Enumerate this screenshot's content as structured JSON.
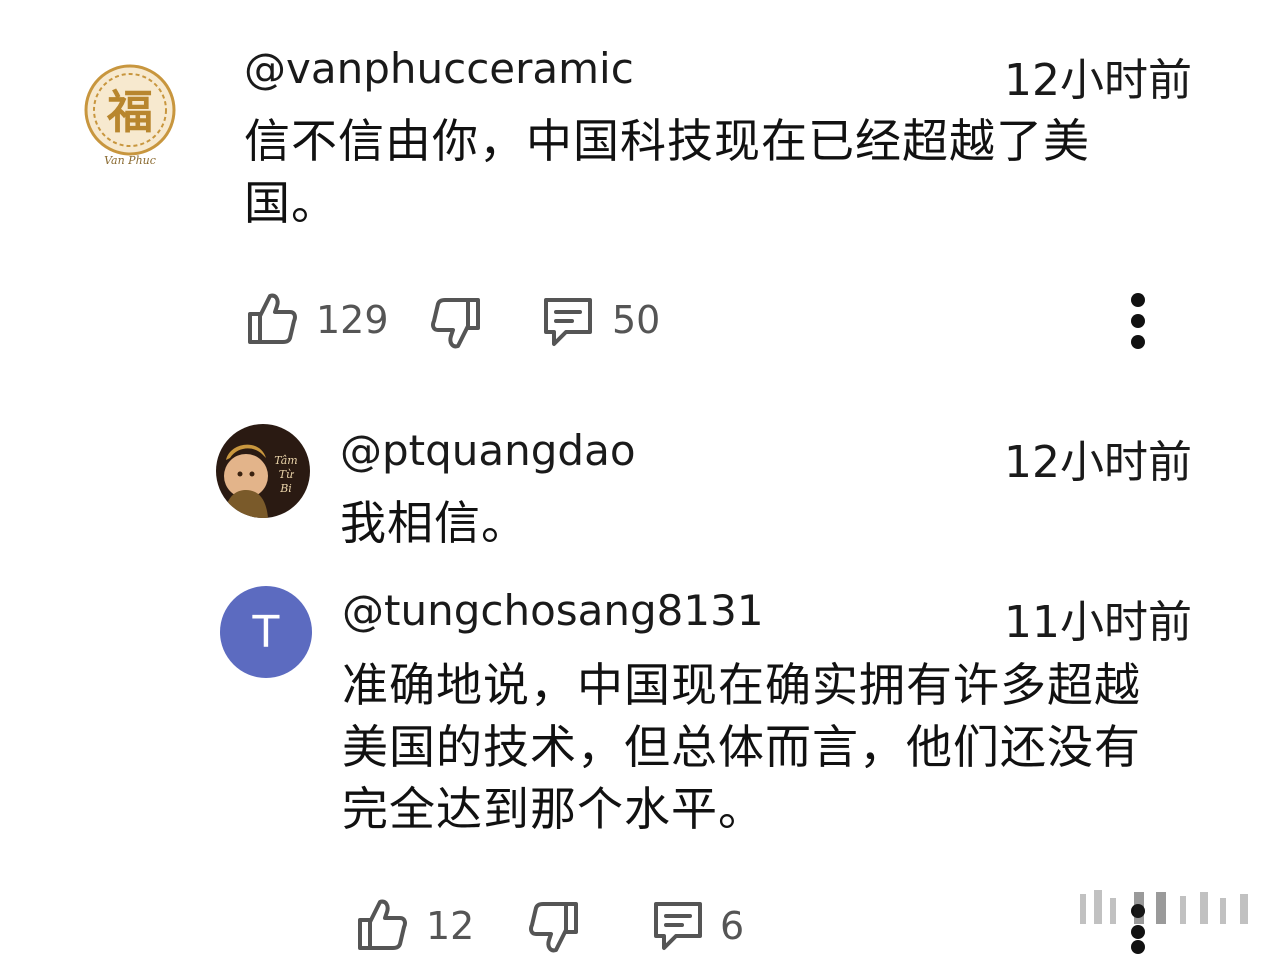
{
  "comments": [
    {
      "handle": "@vanphucceramic",
      "time": "12小时前",
      "text_lines": [
        "信不信由你，中国科技现在已经超越了美",
        "国。"
      ],
      "likes": "129",
      "replies": "50"
    }
  ],
  "replies": [
    {
      "handle": "@ptquangdao",
      "time": "12小时前",
      "text_lines": [
        "我相信。"
      ],
      "avatar_text": "Tâm Từ Bi"
    },
    {
      "handle": "@tungchosang8131",
      "time": "11小时前",
      "avatar_letter": "T",
      "text_lines": [
        "准确地说，中国现在确实拥有许多超越",
        "美国的技术，但总体而言，他们还没有",
        "完全达到那个水平。"
      ],
      "likes": "12",
      "replies": "6"
    }
  ],
  "colors": {
    "avatar_t": "#5c6bc0",
    "gold": "#c8963e",
    "icon": "#555555"
  },
  "icons": [
    "thumb-up-icon",
    "thumb-down-icon",
    "comment-icon",
    "more-vertical-icon"
  ]
}
